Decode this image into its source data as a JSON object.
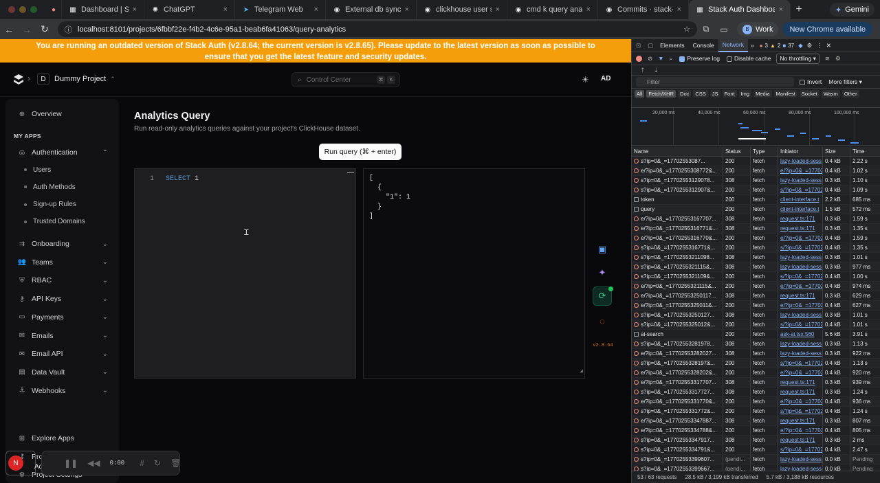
{
  "browser": {
    "tabs": [
      {
        "title": "",
        "icon": "record-icon",
        "color": "#f28b82"
      },
      {
        "title": "Dashboard | Stack Auth",
        "icon": "page-icon",
        "color": "#e8eaed"
      },
      {
        "title": "ChatGPT",
        "icon": "chatgpt-icon",
        "color": "#e8eaed"
      },
      {
        "title": "Telegram Web",
        "icon": "telegram-icon",
        "color": "#5bb3e6"
      },
      {
        "title": "External db sync by aa",
        "icon": "github-icon",
        "color": "#e8eaed"
      },
      {
        "title": "clickhouse user sync b",
        "icon": "github-icon",
        "color": "#e8eaed"
      },
      {
        "title": "cmd k query analytics",
        "icon": "github-icon",
        "color": "#e8eaed"
      },
      {
        "title": "Commits · stack-auth/",
        "icon": "github-icon",
        "color": "#e8eaed"
      },
      {
        "title": "Stack Auth Dashboard",
        "icon": "page-icon",
        "color": "#e8eaed",
        "active": true
      }
    ],
    "gemini_label": "Gemini",
    "url": "localhost:8101/projects/6fbbf22e-f4b2-4c6e-95a1-beab6fa41063/query-analytics",
    "profile_label": "Work",
    "profile_initial": "B",
    "new_chrome_label": "New Chrome available"
  },
  "banner": {
    "text": "You are running an outdated version of Stack Auth (v2.8.64; the current version is v2.8.65). Please update to the latest version as soon as possible to ensure that you get the latest feature and security updates.",
    "color": "#f59e0b"
  },
  "header": {
    "project_initial": "D",
    "project_name": "Dummy Project",
    "control_center_placeholder": "Control Center",
    "shortcut_keys": [
      "⌘",
      "K"
    ],
    "user_initials": "AD"
  },
  "sidebar": {
    "overview": "Overview",
    "section_label": "MY APPS",
    "authentication": "Authentication",
    "auth_subitems": [
      "Users",
      "Auth Methods",
      "Sign-up Rules",
      "Trusted Domains"
    ],
    "apps": [
      "Onboarding",
      "Teams",
      "RBAC",
      "API Keys",
      "Payments",
      "Emails",
      "Email API",
      "Data Vault",
      "Webhooks"
    ],
    "footer": [
      "Explore Apps",
      "Project Keys",
      "Project Settings"
    ]
  },
  "main": {
    "title": "Analytics Query",
    "subtitle": "Run read-only analytics queries against your project's ClickHouse dataset.",
    "run_button": "Run query (⌘ + enter)",
    "editor_line": "1",
    "editor_keyword": "SELECT",
    "editor_value": "1",
    "result_text": "[\n  {\n    \"1\": 1\n  }\n]",
    "version": "v2.8.64"
  },
  "recorder": {
    "time": "0:00",
    "avatar_initial": "N",
    "user_label": "Ad"
  },
  "devtools": {
    "tabs": [
      "Elements",
      "Console",
      "Network"
    ],
    "active_tab": "Network",
    "errors": "3",
    "warnings": "2",
    "messages": "37",
    "preserve_log": "Preserve log",
    "disable_cache": "Disable cache",
    "throttling": "No throttling",
    "filter_placeholder": "Filter",
    "invert": "Invert",
    "more_filters": "More filters",
    "types": [
      "All",
      "Fetch/XHR",
      "Doc",
      "CSS",
      "JS",
      "Font",
      "Img",
      "Media",
      "Manifest",
      "Socket",
      "Wasm",
      "Other"
    ],
    "timeline_labels": [
      "20,000 ms",
      "40,000 ms",
      "60,000 ms",
      "80,000 ms",
      "100,000 ms"
    ],
    "columns": [
      "Name",
      "Status",
      "Type",
      "Initiator",
      "Size",
      "Time"
    ],
    "rows": [
      [
        "s?ip=0&_=17702553087...",
        "200",
        "fetch",
        "lazy-loaded-sess",
        "0.4 kB",
        "2.22 s",
        "err"
      ],
      [
        "e/?ip=0&_=1770255308772&...",
        "200",
        "fetch",
        "e/?ip=0&_=17702",
        "0.4 kB",
        "1.02 s",
        "err"
      ],
      [
        "s?ip=0&_=17702553129078...",
        "308",
        "fetch",
        "lazy-loaded-sess",
        "0.3 kB",
        "1.10 s",
        "err"
      ],
      [
        "s?ip=0&_=1770255312907&...",
        "200",
        "fetch",
        "s/?ip=0&_=17702",
        "0.4 kB",
        "1.09 s",
        "err"
      ],
      [
        "token",
        "200",
        "fetch",
        "client-interface.t",
        "2.2 kB",
        "685 ms",
        "ok"
      ],
      [
        "query",
        "200",
        "fetch",
        "client-interface.t",
        "1.5 kB",
        "572 ms",
        "ok"
      ],
      [
        "e/?ip=0&_=17702553167707...",
        "308",
        "fetch",
        "request.ts:171",
        "0.3 kB",
        "1.59 s",
        "err"
      ],
      [
        "e/?ip=0&_=1770255316771&...",
        "308",
        "fetch",
        "request.ts:171",
        "0.3 kB",
        "1.35 s",
        "err"
      ],
      [
        "e/?ip=0&_=1770255316770&...",
        "200",
        "fetch",
        "e/?ip=0&_=17702",
        "0.4 kB",
        "1.59 s",
        "err"
      ],
      [
        "s?ip=0&_=1770255316771&...",
        "200",
        "fetch",
        "s/?ip=0&_=17702",
        "0.4 kB",
        "1.35 s",
        "err"
      ],
      [
        "s?ip=0&_=17702553211098...",
        "308",
        "fetch",
        "lazy-loaded-sess",
        "0.3 kB",
        "1.01 s",
        "err"
      ],
      [
        "s?ip=0&_=1770255321115&...",
        "308",
        "fetch",
        "lazy-loaded-sess",
        "0.3 kB",
        "977 ms",
        "err"
      ],
      [
        "s?ip=0&_=1770255321109&...",
        "200",
        "fetch",
        "s/?ip=0&_=17702",
        "0.4 kB",
        "1.00 s",
        "err"
      ],
      [
        "e/?ip=0&_=1770255321115&...",
        "200",
        "fetch",
        "e/?ip=0&_=17702",
        "0.4 kB",
        "974 ms",
        "err"
      ],
      [
        "e/?ip=0&_=17702553250117...",
        "308",
        "fetch",
        "request.ts:171",
        "0.3 kB",
        "629 ms",
        "err"
      ],
      [
        "e/?ip=0&_=1770255325011&...",
        "200",
        "fetch",
        "e/?ip=0&_=17702",
        "0.4 kB",
        "627 ms",
        "err"
      ],
      [
        "s?ip=0&_=17702553250127...",
        "308",
        "fetch",
        "lazy-loaded-sess",
        "0.3 kB",
        "1.01 s",
        "err"
      ],
      [
        "s?ip=0&_=1770255325012&...",
        "200",
        "fetch",
        "s/?ip=0&_=17702",
        "0.4 kB",
        "1.01 s",
        "err"
      ],
      [
        "ai-search",
        "200",
        "fetch",
        "ask-ai.tsx:560",
        "5.6 kB",
        "3.91 s",
        "ok"
      ],
      [
        "s?ip=0&_=17702553281978...",
        "308",
        "fetch",
        "lazy-loaded-sess",
        "0.3 kB",
        "1.13 s",
        "err"
      ],
      [
        "e/?ip=0&_=17702553282027...",
        "308",
        "fetch",
        "lazy-loaded-sess",
        "0.3 kB",
        "922 ms",
        "err"
      ],
      [
        "s?ip=0&_=1770255328197&...",
        "200",
        "fetch",
        "s/?ip=0&_=17702",
        "0.4 kB",
        "1.13 s",
        "err"
      ],
      [
        "e/?ip=0&_=1770255328202&...",
        "200",
        "fetch",
        "e/?ip=0&_=17702",
        "0.4 kB",
        "920 ms",
        "err"
      ],
      [
        "e/?ip=0&_=17702553317707...",
        "308",
        "fetch",
        "request.ts:171",
        "0.3 kB",
        "939 ms",
        "err"
      ],
      [
        "s?ip=0&_=17702553317727...",
        "308",
        "fetch",
        "request.ts:171",
        "0.3 kB",
        "1.24 s",
        "err"
      ],
      [
        "e/?ip=0&_=1770255331770&...",
        "200",
        "fetch",
        "e/?ip=0&_=17702",
        "0.4 kB",
        "936 ms",
        "err"
      ],
      [
        "s?ip=0&_=1770255331772&...",
        "200",
        "fetch",
        "s/?ip=0&_=17702",
        "0.4 kB",
        "1.24 s",
        "err"
      ],
      [
        "e/?ip=0&_=17702553347887...",
        "308",
        "fetch",
        "request.ts:171",
        "0.3 kB",
        "807 ms",
        "err"
      ],
      [
        "e/?ip=0&_=1770255334788&...",
        "200",
        "fetch",
        "e/?ip=0&_=17702",
        "0.4 kB",
        "805 ms",
        "err"
      ],
      [
        "s?ip=0&_=17702553347917...",
        "308",
        "fetch",
        "request.ts:171",
        "0.3 kB",
        "2 ms",
        "err"
      ],
      [
        "s?ip=0&_=1770255334791&...",
        "200",
        "fetch",
        "s/?ip=0&_=17702",
        "0.4 kB",
        "2.47 s",
        "err"
      ],
      [
        "s?ip=0&_=17702553399607...",
        "(pendi...",
        "fetch",
        "lazy-loaded-sess",
        "0.0 kB",
        "Pending",
        "err"
      ],
      [
        "s?ip=0&_=17702553399667...",
        "(pendi...",
        "fetch",
        "lazy-loaded-sess",
        "0.0 kB",
        "Pending",
        "err"
      ]
    ],
    "status_requests": "53 / 63 requests",
    "status_transferred": "28.5 kB / 3,199 kB transferred",
    "status_resources": "5.7 kB / 3,188 kB resources"
  }
}
